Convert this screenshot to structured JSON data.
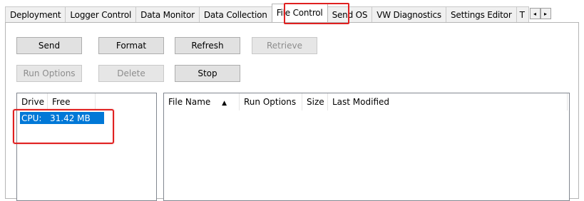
{
  "tabs": [
    {
      "label": "Deployment",
      "active": false
    },
    {
      "label": "Logger Control",
      "active": false
    },
    {
      "label": "Data Monitor",
      "active": false
    },
    {
      "label": "Data Collection",
      "active": false
    },
    {
      "label": "File Control",
      "active": true
    },
    {
      "label": "Send OS",
      "active": false
    },
    {
      "label": "VW Diagnostics",
      "active": false
    },
    {
      "label": "Settings Editor",
      "active": false
    },
    {
      "label": "T",
      "active": false
    }
  ],
  "tab_scroll": {
    "left_icon": "arrow-left-icon",
    "right_icon": "arrow-right-icon",
    "left_glyph": "◂",
    "right_glyph": "▸"
  },
  "buttons": {
    "send": {
      "label": "Send",
      "enabled": true
    },
    "format": {
      "label": "Format",
      "enabled": true
    },
    "refresh": {
      "label": "Refresh",
      "enabled": true
    },
    "retrieve": {
      "label": "Retrieve",
      "enabled": false
    },
    "run_options": {
      "label": "Run Options",
      "enabled": false
    },
    "delete": {
      "label": "Delete",
      "enabled": false
    },
    "stop": {
      "label": "Stop",
      "enabled": true
    }
  },
  "drives_list": {
    "columns": [
      "Drive",
      "Free"
    ],
    "rows": [
      {
        "drive": "CPU:",
        "free": "31.42 MB",
        "selected": true
      }
    ]
  },
  "files_list": {
    "columns": [
      "File Name",
      "Run Options",
      "Size",
      "Last Modified"
    ],
    "sort_indicator": "▲",
    "rows": []
  },
  "colors": {
    "highlight": "#e02020",
    "selection": "#0078d7"
  }
}
